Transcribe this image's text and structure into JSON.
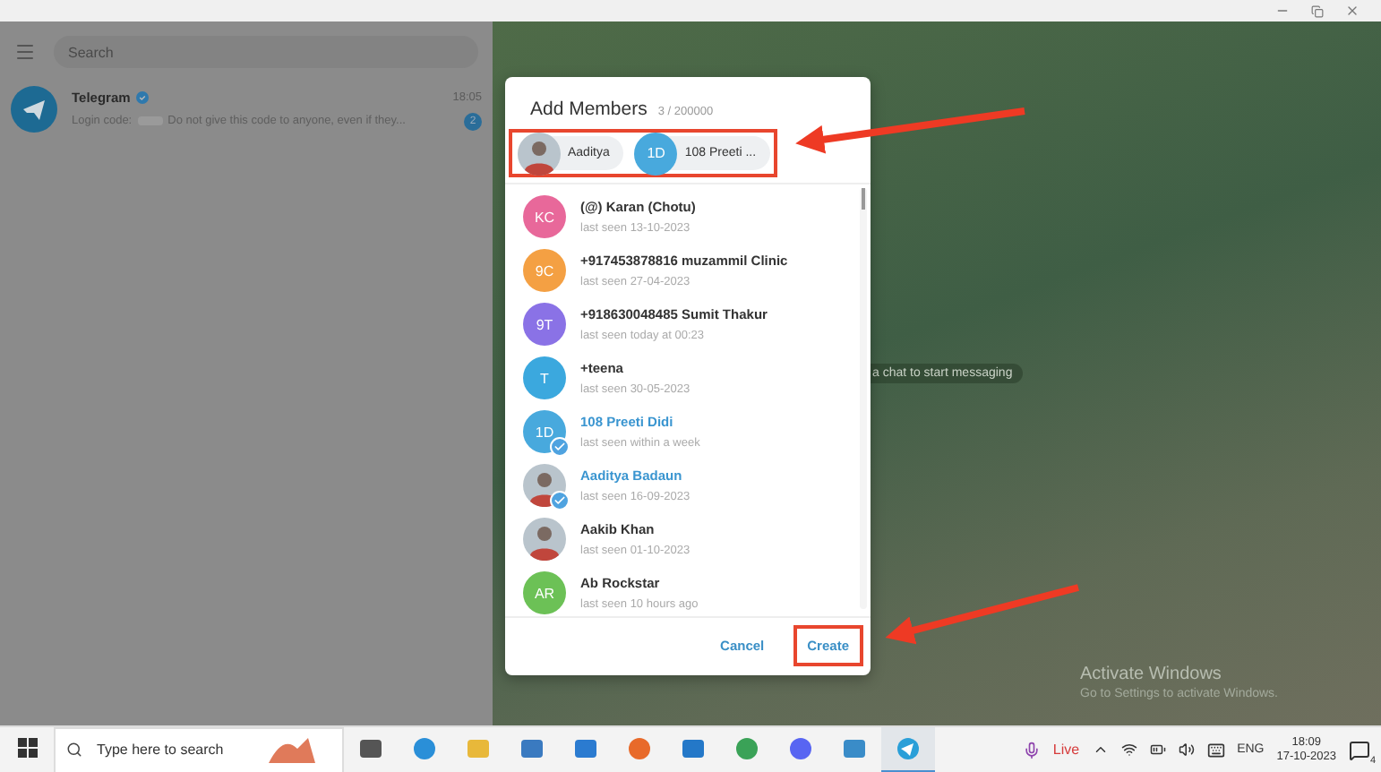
{
  "sidebar": {
    "search": {
      "placeholder": "Search"
    },
    "chats": [
      {
        "name": "Telegram",
        "verified": true,
        "time": "18:05",
        "preview": "Do not give this code to anyone, even if they...",
        "preview_label": "Login code:",
        "unread": "2"
      }
    ]
  },
  "background": {
    "hint": "a chat to start messaging"
  },
  "dialog": {
    "title": "Add Members",
    "count": "3 / 200000",
    "chips_highlighted": true,
    "chips": [
      {
        "label": "Aaditya",
        "avatar": {
          "kind": "photo"
        }
      },
      {
        "label": "108 Preeti ...",
        "avatar": {
          "kind": "initials",
          "initials": "1D",
          "color": "#48a9dd"
        }
      }
    ],
    "contacts": [
      {
        "name": "(@) Karan (Chotu)",
        "status": "last seen 13-10-2023",
        "selected": false,
        "avatar": {
          "kind": "initials",
          "initials": "KC",
          "color": "#e8689a"
        }
      },
      {
        "name": "+917453878816 muzammil Clinic",
        "status": "last seen 27-04-2023",
        "selected": false,
        "avatar": {
          "kind": "initials",
          "initials": "9C",
          "color": "#f4a043"
        }
      },
      {
        "name": "+918630048485 Sumit Thakur",
        "status": "last seen today at 00:23",
        "selected": false,
        "avatar": {
          "kind": "initials",
          "initials": "9T",
          "color": "#8a72e6"
        }
      },
      {
        "name": "+teena",
        "status": "last seen 30-05-2023",
        "selected": false,
        "avatar": {
          "kind": "initials",
          "initials": "T",
          "color": "#3ba8de"
        }
      },
      {
        "name": "108 Preeti Didi",
        "status": "last seen within a week",
        "selected": true,
        "avatar": {
          "kind": "initials",
          "initials": "1D",
          "color": "#48a9dd"
        }
      },
      {
        "name": "Aaditya Badaun",
        "status": "last seen 16-09-2023",
        "selected": true,
        "avatar": {
          "kind": "photo"
        }
      },
      {
        "name": "Aakib Khan",
        "status": "last seen 01-10-2023",
        "selected": false,
        "avatar": {
          "kind": "photo"
        }
      },
      {
        "name": "Ab Rockstar",
        "status": "last seen 10 hours ago",
        "selected": false,
        "avatar": {
          "kind": "initials",
          "initials": "AR",
          "color": "#6cc156"
        }
      }
    ],
    "buttons": [
      {
        "label": "Cancel",
        "highlighted": false
      },
      {
        "label": "Create",
        "highlighted": true
      }
    ]
  },
  "activation": {
    "title": "Activate Windows",
    "subtitle": "Go to Settings to activate Windows."
  },
  "taskbar": {
    "search_placeholder": "Type here to search",
    "live": "Live",
    "language": "ENG",
    "time": "18:09",
    "date": "17-10-2023",
    "notifications": "4"
  }
}
